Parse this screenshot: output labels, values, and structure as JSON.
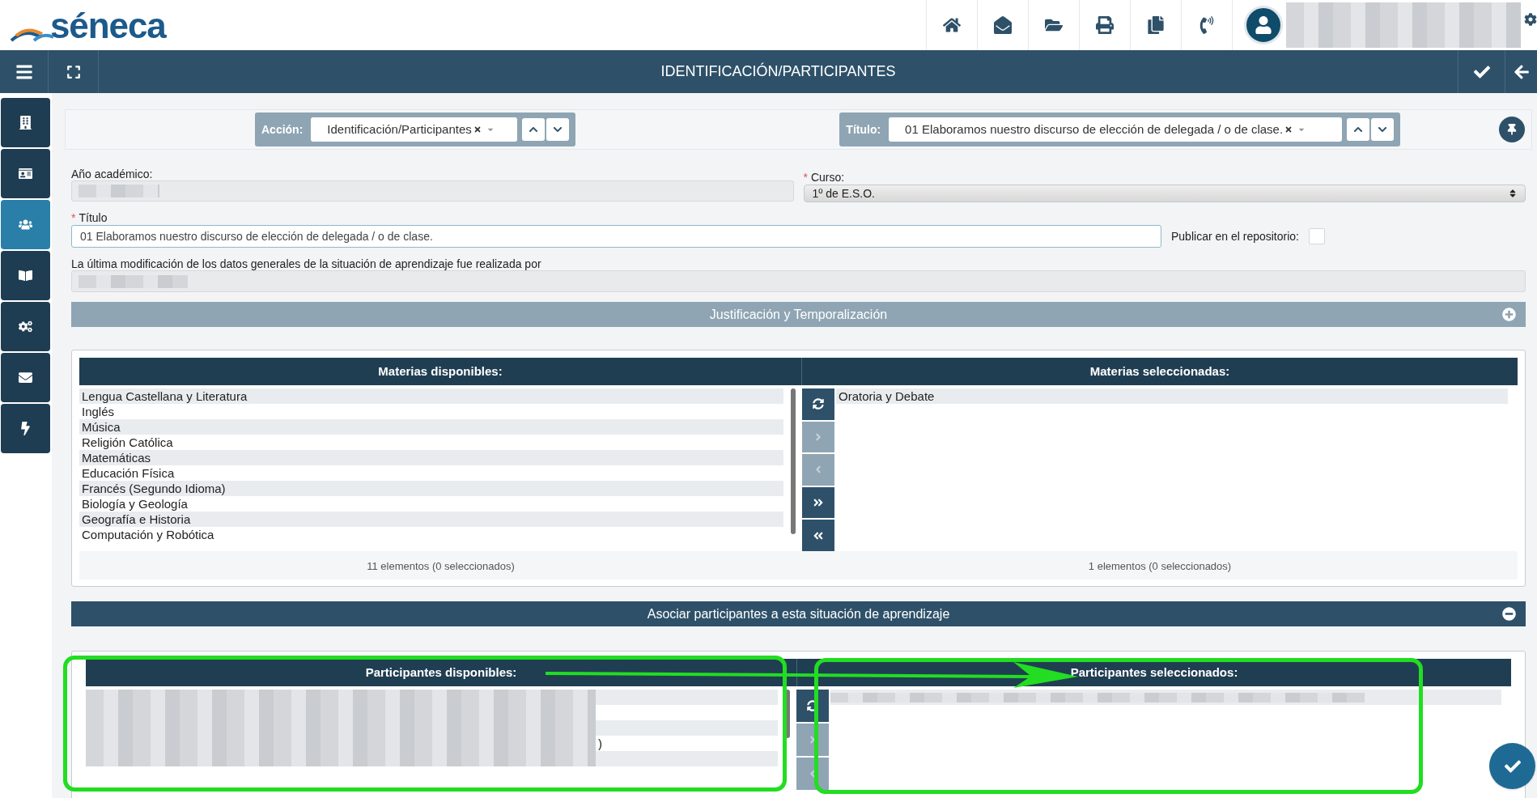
{
  "logo": {
    "text": "séneca"
  },
  "header": {
    "page_title": "IDENTIFICACIÓN/PARTICIPANTES"
  },
  "sidebar": {
    "items": [
      {
        "kind": "building",
        "selected": false
      },
      {
        "kind": "card",
        "selected": false
      },
      {
        "kind": "group",
        "selected": true
      },
      {
        "kind": "book",
        "selected": false
      },
      {
        "kind": "gears",
        "selected": false
      },
      {
        "kind": "mail",
        "selected": false
      },
      {
        "kind": "bolt",
        "selected": false
      }
    ]
  },
  "toolbar": {
    "accion": {
      "label": "Acción:",
      "value": "Identificación/Participantes"
    },
    "titulo": {
      "label": "Título:",
      "value": "01 Elaboramos nuestro discurso de elección de delegada / o de clase."
    }
  },
  "form": {
    "anio_label": "Año académico:",
    "curso": {
      "required_mark": "*",
      "label": "Curso:",
      "value": "1º de E.S.O."
    },
    "titulo": {
      "required_mark": "*",
      "label": "Título",
      "value": "01 Elaboramos nuestro discurso de elección de delegada / o de clase."
    },
    "publicar": {
      "label": "Publicar en el repositorio:",
      "checked": false
    },
    "modificacion_label": "La última modificación de los datos generales de la situación de aprendizaje fue realizada por"
  },
  "section_justificacion": {
    "title": "Justificación y Temporalización",
    "expanded": false
  },
  "materias": {
    "available_title": "Materias disponibles:",
    "selected_title": "Materias seleccionadas:",
    "available": [
      "Lengua Castellana y Literatura",
      "Inglés",
      "Música",
      "Religión Católica",
      "Matemáticas",
      "Educación Física",
      "Francés (Segundo Idioma)",
      "Biología y Geología",
      "Geografía e Historia",
      "Computación y Robótica"
    ],
    "selected": [
      "Oratoria y Debate"
    ],
    "available_count": "11 elementos (0 seleccionados)",
    "selected_count": "1 elementos (0 seleccionados)",
    "buttons": [
      {
        "kind": "refresh",
        "disabled": false
      },
      {
        "kind": "right",
        "disabled": true
      },
      {
        "kind": "left",
        "disabled": true
      },
      {
        "kind": "all_right",
        "disabled": false
      },
      {
        "kind": "all_left",
        "disabled": false
      }
    ]
  },
  "section_participantes": {
    "title": "Asociar participantes a esta situación de aprendizaje",
    "expanded": true
  },
  "participantes": {
    "available_title": "Participantes disponibles:",
    "selected_title": "Participantes seleccionados:",
    "fragment": ")",
    "buttons": [
      {
        "kind": "refresh",
        "disabled": false
      },
      {
        "kind": "right",
        "disabled": true
      },
      {
        "kind": "left",
        "disabled": true
      }
    ]
  }
}
